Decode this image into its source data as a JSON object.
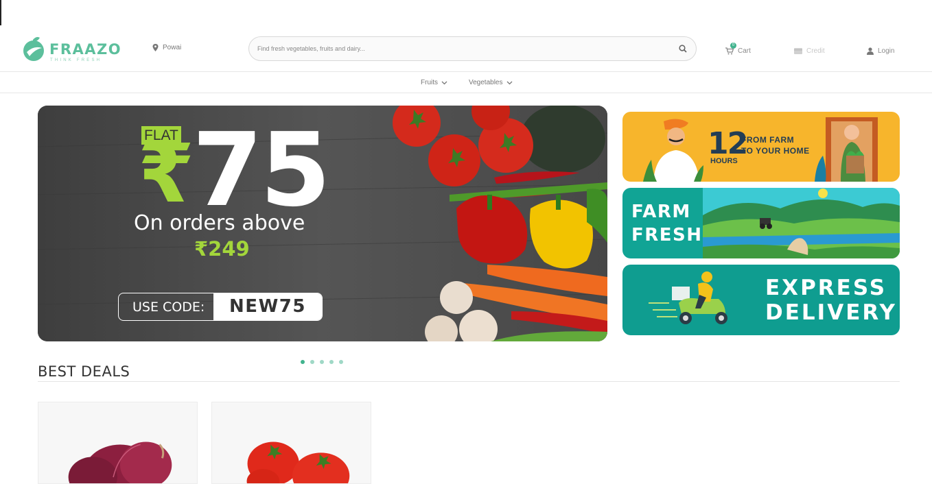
{
  "brand": {
    "name": "FRAAZO",
    "tagline": "THINK FRESH",
    "color": "#5cbf9c"
  },
  "location": {
    "label": "Powai",
    "icon": "map-pin-icon"
  },
  "search": {
    "placeholder": "Find fresh vegetables, fruits and dairy...",
    "icon": "search-icon"
  },
  "nav": {
    "cart_label": "Cart",
    "cart_count": "0",
    "credit_label": "Credit",
    "login_label": "Login"
  },
  "categories": [
    {
      "label": "Fruits",
      "icon": "chevron-down-icon"
    },
    {
      "label": "Vegetables",
      "icon": "chevron-down-icon"
    }
  ],
  "hero": {
    "flat": "FLAT",
    "rupee": "₹",
    "amount": "75",
    "orders_above": "On orders above",
    "min_amount": "₹249",
    "use_code_label": "USE CODE:",
    "code": "NEW75"
  },
  "side_banners": {
    "farm_hours_number": "12",
    "farm_hours_unit": "HOURS",
    "farm_from_line1": "FROM FARM",
    "farm_from_line2": "TO YOUR HOME",
    "farm_fresh_line1": "FARM",
    "farm_fresh_line2": "FRESH",
    "express_line1": "EXPRESS",
    "express_line2": "DELIVERY"
  },
  "carousel": {
    "total": 5,
    "active": 1
  },
  "best_deals": {
    "title": "BEST DEALS",
    "items": [
      "onion",
      "tomato"
    ]
  },
  "colors": {
    "accent": "#41b38e",
    "lime": "#a3d63b",
    "yellow_banner": "#f7b52c",
    "teal_banner": "#0f9d90"
  }
}
